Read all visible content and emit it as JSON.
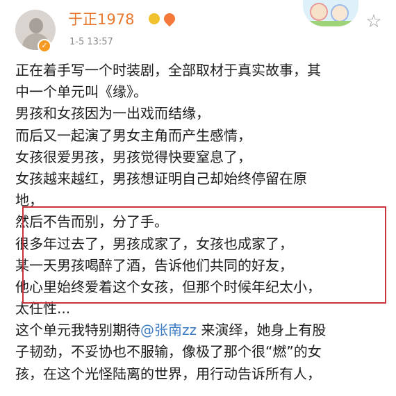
{
  "post": {
    "username": "于正1978",
    "timestamp": "1-5 13:57",
    "badges": [
      "crown-badge-icon",
      "heart-badge-icon"
    ],
    "lines_before": [
      "正在着手写一个时装剧，全部取材于真实故事，其",
      "中一个单元叫《缘》。",
      "男孩和女孩因为一出戏而结缘，",
      "而后又一起演了男女主角而产生感情，"
    ],
    "highlight_lines": [
      "女孩很爱男孩，男孩觉得快要窒息了，",
      "女孩越来越红，男孩想证明自己却始终停留在原",
      "地，",
      "然后不告而别，分了手。"
    ],
    "lines_after": [
      "很多年过去了，男孩成家了，女孩也成家了，",
      "某一天男孩喝醉了酒，告诉他们共同的好友，",
      "他心里始终爱着这个女孩，但那个时候年纪太小，",
      "太任性..."
    ],
    "mention_line": {
      "prefix": "这个单元我特别期待",
      "mention": "@张南zz",
      "suffix": " 来演绎，她身上有股"
    },
    "lines_end": [
      "子韧劲，不妥协也不服输，像极了那个很“燃”的女",
      "孩，在这个光怪陆离的世界，用行动告诉所有人，"
    ]
  },
  "colors": {
    "username": "#e8782d",
    "mention": "#3e7cc2",
    "highlight_border": "#c8323c",
    "timestamp": "#888888"
  }
}
